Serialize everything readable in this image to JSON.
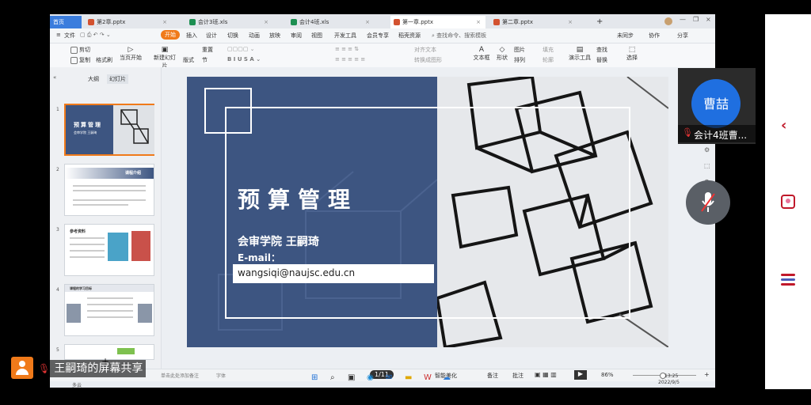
{
  "tabs": [
    {
      "label": "首页",
      "color": "#3b7ddd"
    },
    {
      "label": "第2章.pptx",
      "color": "#d35230"
    },
    {
      "label": "会计3班.xls",
      "color": "#1d8f52"
    },
    {
      "label": "会计4班.xls",
      "color": "#1d8f52"
    },
    {
      "label": "第一章.pptx",
      "color": "#d35230"
    },
    {
      "label": "第二章.pptx",
      "color": "#d35230"
    }
  ],
  "new_tab": "+",
  "menu": [
    "文件",
    "开始",
    "插入",
    "设计",
    "切换",
    "动画",
    "放映",
    "审阅",
    "视图",
    "开发工具",
    "会员专享",
    "稻壳资源"
  ],
  "menu_search": "查找命令、搜索模板",
  "menu_right": [
    "未同步",
    "协作",
    "分享"
  ],
  "ribbon": [
    "格式刷",
    "当页开始",
    "新建幻灯片",
    "版式",
    "节",
    "重置",
    "对齐文本",
    "转换成图形",
    "文本框",
    "形状",
    "图片",
    "排列",
    "填充",
    "轮廓",
    "演示工具",
    "查找",
    "替换",
    "选择"
  ],
  "ribbon_top_left": [
    "剪切",
    "复制"
  ],
  "left_tabs": [
    "大纲",
    "幻灯片"
  ],
  "thumbs": [
    {
      "num": "1",
      "title": "预算管理",
      "sub": "会审学院 王嗣琦"
    },
    {
      "num": "2",
      "title": "课程介绍"
    },
    {
      "num": "3",
      "title": "参考资料"
    },
    {
      "num": "4",
      "title": "课程的学习目标"
    },
    {
      "num": "5",
      "title": ""
    }
  ],
  "slide": {
    "title": "预算管理",
    "author": "会审学院 王嗣琦",
    "email_label": "E-mail：",
    "email": "wangsiqi@naujsc.edu.cn"
  },
  "status": {
    "page": "1/11",
    "smart": "智能美化",
    "notes": "备注",
    "comment": "批注",
    "zoom": "86%",
    "add_note": "单击此处添加备注",
    "font_hint": "字体"
  },
  "taskbar": {
    "time": "13:25",
    "date": "2022/9/5",
    "weather": "多云"
  },
  "video": {
    "avatar_name": "曹喆",
    "caption": "会计4班曹..."
  },
  "share_label": "王嗣琦的屏幕共享"
}
